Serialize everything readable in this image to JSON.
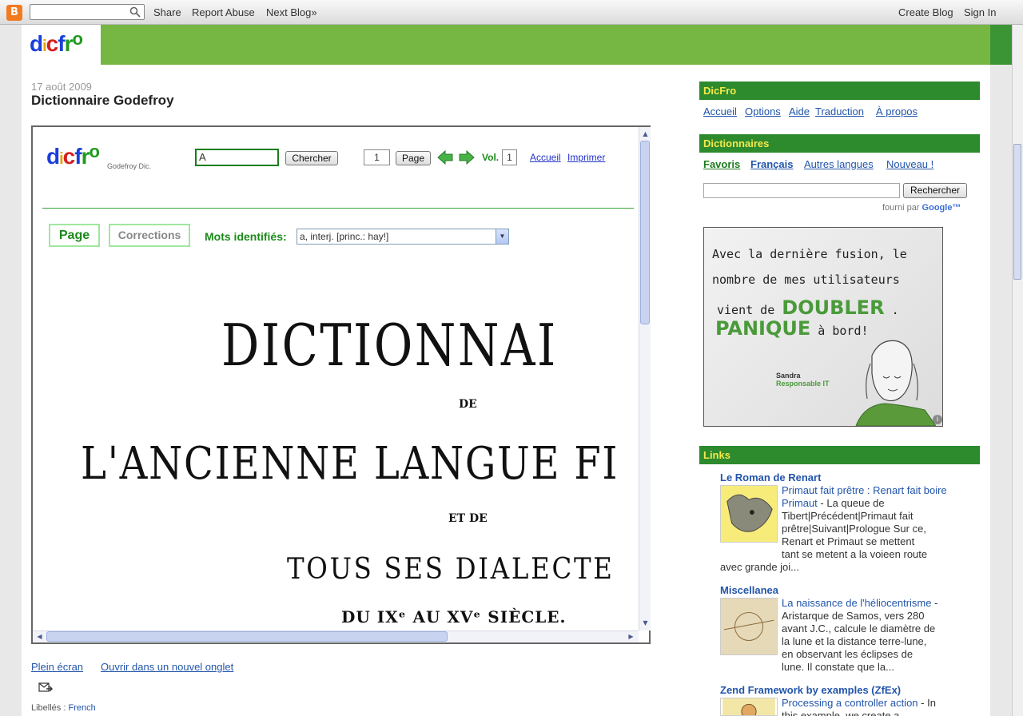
{
  "navbar": {
    "logo_letter": "B",
    "search_placeholder": "",
    "share": "Share",
    "report_abuse": "Report Abuse",
    "next_blog": "Next Blog»",
    "create_blog": "Create Blog",
    "sign_in": "Sign In"
  },
  "header": {
    "logo": [
      "d",
      "i",
      "c",
      "f",
      "r",
      "o"
    ]
  },
  "post": {
    "date": "17 août 2009",
    "title": "Dictionnaire Godefroy"
  },
  "embed": {
    "logo_sub": "Godefroy Dic.",
    "query": "A",
    "search_button": "Chercher",
    "page_number": "1",
    "page_button": "Page",
    "vol_label": "Vol.",
    "vol_number": "1",
    "accueil": "Accueil",
    "imprimer": "Imprimer",
    "tab_page": "Page",
    "tab_corrections": "Corrections",
    "mots_label": "Mots identifiés:",
    "mots_selected": "a, interj. [princ.: hay!]",
    "scan_lines": [
      "DICTIONNAI",
      "DE",
      "L'ANCIENNE LANGUE FI",
      "ET DE",
      "TOUS SES DIALECTE",
      "DU IXᵉ AU XVᵉ SIÈCLE."
    ]
  },
  "under": {
    "plein_ecran": "Plein écran",
    "nouvel_onglet": "Ouvrir dans un nouvel onglet",
    "labels_prefix": "Libellés :",
    "label_link": "French"
  },
  "sidebar": {
    "dicfro_title": "DicFro",
    "dicfro_links": [
      "Accueil",
      "Options",
      "Aide",
      "Traduction",
      "À propos"
    ],
    "dictionnaires_title": "Dictionnaires",
    "dict_tabs": [
      "Favoris",
      "Français",
      "Autres langues",
      "Nouveau !"
    ],
    "search_button": "Rechercher",
    "fourni_par": "fourni par",
    "google": "Google™",
    "ad": {
      "line1": "Avec la dernière fusion, le",
      "line2": "nombre de mes utilisateurs",
      "line3a": "vient de",
      "doubler": "DOUBLER",
      "line3b": ".",
      "panique": "PANIQUE",
      "line4b": "à bord!",
      "name": "Sandra",
      "role": "Responsable IT"
    },
    "links_title": "Links",
    "links": [
      {
        "title": "Le Roman de Renart",
        "link": "Primaut fait prêtre : Renart fait boire Primaut",
        "text": [
          " - La queue de",
          "Tibert|Précédent|Primaut fait",
          "prêtre|Suivant|Prologue Sur ce,",
          "Renart et Primaut se mettent",
          "tant se metent a la voieen route",
          "avec grande joi..."
        ]
      },
      {
        "title": "Miscellanea",
        "link": "La naissance de l'héliocentrisme",
        "text": [
          " -",
          "Aristarque de Samos, vers 280",
          "avant J.C., calcule le diamètre de",
          "la lune et la distance terre-lune,",
          "en observant les éclipses de",
          "lune. Il constate que la..."
        ]
      },
      {
        "title": "Zend Framework by examples (ZfEx)",
        "link": "Processing a controller action",
        "text": [
          " - In",
          "this example, we create a..."
        ]
      }
    ]
  },
  "colors": {
    "header_green": "#76b743",
    "sidebar_green": "#2d8a2d",
    "accent_yellow": "#f5e94a",
    "link_blue": "#2255aa"
  }
}
